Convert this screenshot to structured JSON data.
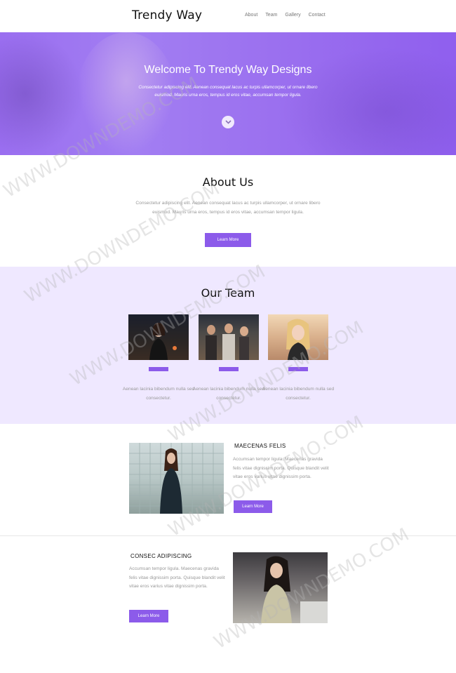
{
  "header": {
    "brand": "Trendy Way",
    "nav": [
      {
        "label": "About"
      },
      {
        "label": "Team"
      },
      {
        "label": "Gallery"
      },
      {
        "label": "Contact"
      }
    ]
  },
  "hero": {
    "title": "Welcome To Trendy Way Designs",
    "text": "Consectetur adipiscing elit. Aenean consequat lacus ac turpis ullamcorper, ut ornare libero euismod. Mauris urna eros, tempus id eros vitae, accumsan tempor ligula.",
    "arrow_icon": "chevron-down-icon"
  },
  "about": {
    "title": "About Us",
    "text": "Consectetur adipiscing elit. Aenean consequat lacus ac turpis ullamcorper, ut ornare libero euismod. Mauris urna eros, tempus id eros vitae, accumsan tempor ligula.",
    "button": "Learn More"
  },
  "team": {
    "title": "Our Team",
    "members": [
      {
        "desc": "Aenean lacinia bibendum nulla sed consectetur."
      },
      {
        "desc": "Aenean lacinia bibendum nulla sed consectetur."
      },
      {
        "desc": "Aenean lacinia bibendum nulla sed consectetur."
      }
    ]
  },
  "feature1": {
    "title": "MAECENAS FELIS",
    "text": "Accumsan tempor ligula. Maecenas gravida felis vitae dignissim porta. Quisque blandit velit vitae eros varius vitae dignissim porta.",
    "button": "Learn More"
  },
  "feature2": {
    "title": "CONSEC ADIPISCING",
    "text": "Accumsan tempor ligula. Maecenas gravida felis vitae dignissim porta. Quisque blandit velit vitae eros varius vitae dignissim porta.",
    "button": "Learn More"
  },
  "watermark": "WWW.DOWNDEMO.COM",
  "colors": {
    "accent": "#8c5bea",
    "hero": "#9b70ef",
    "team_bg": "#efe8ff"
  }
}
